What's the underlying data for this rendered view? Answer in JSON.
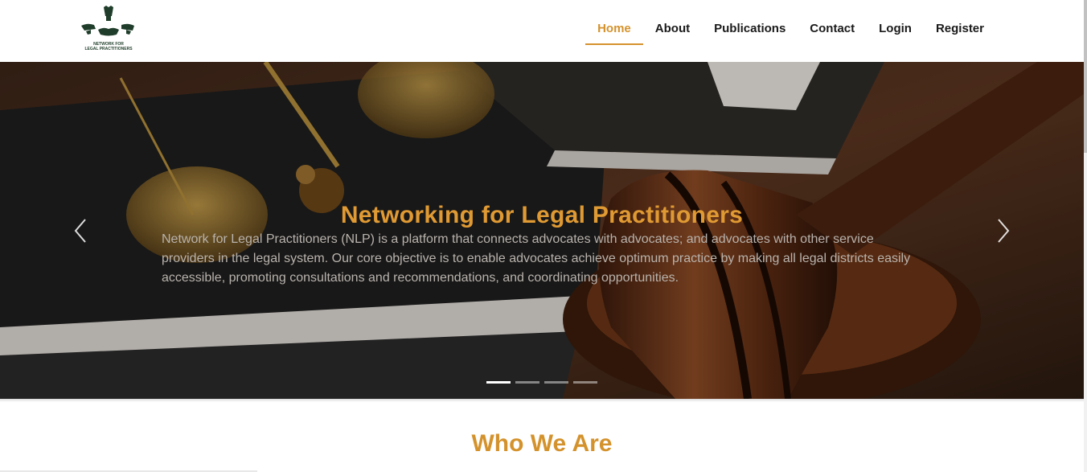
{
  "brand": {
    "logo_text": "NETWORK FOR\nLEGAL PRACTITIONERS"
  },
  "nav": {
    "items": [
      {
        "label": "Home",
        "active": true
      },
      {
        "label": "About",
        "active": false
      },
      {
        "label": "Publications",
        "active": false
      },
      {
        "label": "Contact",
        "active": false
      },
      {
        "label": "Login",
        "active": false
      },
      {
        "label": "Register",
        "active": false
      }
    ]
  },
  "hero": {
    "title": "Networking for Legal Practitioners",
    "text": "Network for Legal Practitioners (NLP) is a platform that connects advocates with advocates; and advocates with other service providers in the legal system. Our core objective is to enable advocates achieve optimum practice by making all legal districts easily accessible, promoting consultations and recommendations, and coordinating opportunities.",
    "prev_icon": "chevron-left-icon",
    "next_icon": "chevron-right-icon",
    "slide_count": 4,
    "active_slide": 1
  },
  "section": {
    "title": "Who We Are"
  },
  "colors": {
    "accent": "#d4922c",
    "hero_title": "#e09a33",
    "logo_green": "#1f3d2a"
  }
}
